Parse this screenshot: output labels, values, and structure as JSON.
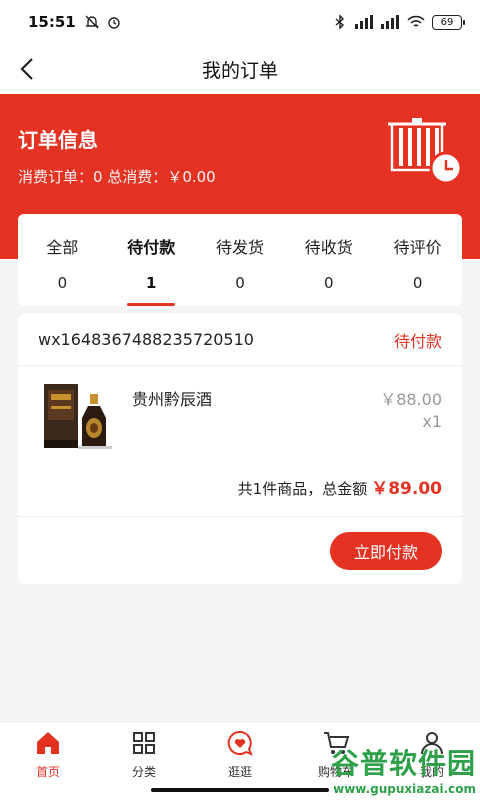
{
  "status_bar": {
    "time": "15:51",
    "battery": "69"
  },
  "nav": {
    "title": "我的订单"
  },
  "header": {
    "title": "订单信息",
    "subtitle": "消费订单：0 总消费：￥0.00"
  },
  "tabs": [
    {
      "label": "全部",
      "count": "0"
    },
    {
      "label": "待付款",
      "count": "1"
    },
    {
      "label": "待发货",
      "count": "0"
    },
    {
      "label": "待收货",
      "count": "0"
    },
    {
      "label": "待评价",
      "count": "0"
    }
  ],
  "order": {
    "number": "wx1648367488235720510",
    "status": "待付款",
    "product": {
      "name": "贵州黔辰酒",
      "price": "￥88.00",
      "qty": "x1"
    },
    "summary_text": "共1件商品，总金额",
    "total": "￥89.00",
    "pay_button": "立即付款"
  },
  "tab_bar": [
    {
      "label": "首页",
      "icon": "home-icon"
    },
    {
      "label": "分类",
      "icon": "grid-icon"
    },
    {
      "label": "逛逛",
      "icon": "heart-chat-icon"
    },
    {
      "label": "购物车",
      "icon": "cart-icon"
    },
    {
      "label": "我的",
      "icon": "user-icon"
    }
  ],
  "watermark": {
    "main": "谷普软件园",
    "url": "www.gupuxiazai.com"
  },
  "colors": {
    "accent": "#e53223"
  }
}
